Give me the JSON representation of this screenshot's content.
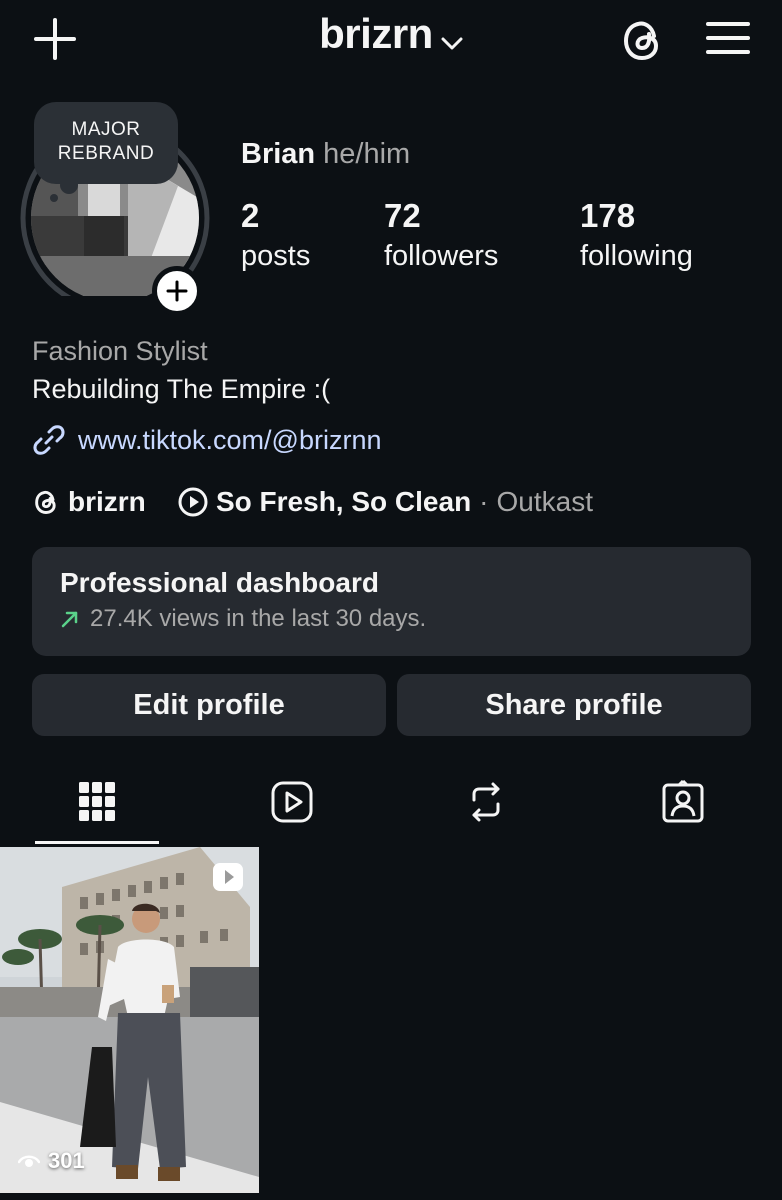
{
  "header": {
    "username": "brizrn"
  },
  "profile": {
    "note": [
      "MAJOR",
      "REBRAND"
    ],
    "name": "Brian",
    "pronouns": "he/him",
    "stats": {
      "posts": {
        "value": "2",
        "label": "posts"
      },
      "followers": {
        "value": "72",
        "label": "followers"
      },
      "following": {
        "value": "178",
        "label": "following"
      }
    },
    "category": "Fashion Stylist",
    "bio": "Rebuilding The Empire :(",
    "link": "www.tiktok.com/@brizrnn",
    "threads_handle": "brizrn",
    "music": {
      "song": "So Fresh, So Clean",
      "separator": "·",
      "artist": "Outkast"
    }
  },
  "dashboard": {
    "title": "Professional dashboard",
    "subtitle": "27.4K views in the last 30 days."
  },
  "buttons": {
    "edit": "Edit profile",
    "share": "Share profile"
  },
  "tabs": {
    "active": "grid",
    "items": [
      "grid-icon",
      "reels-icon",
      "reposts-icon",
      "tagged-icon"
    ]
  },
  "posts": [
    {
      "type": "reel",
      "views": "301"
    }
  ],
  "colors": {
    "background": "#0c1014",
    "surface": "#262a30",
    "link": "#c8d8ff",
    "trend": "#5ad28a"
  }
}
